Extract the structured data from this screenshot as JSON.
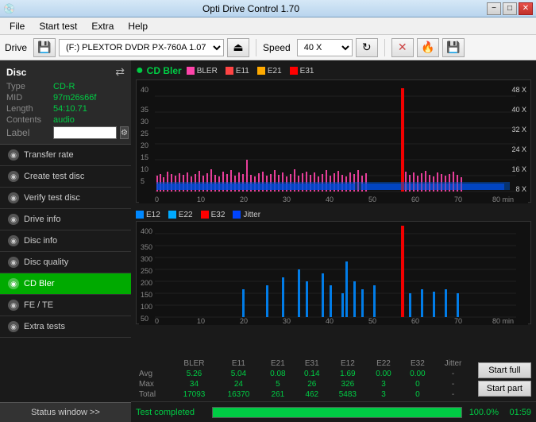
{
  "titlebar": {
    "icon": "💿",
    "title": "Opti Drive Control 1.70",
    "minimize": "−",
    "maximize": "□",
    "close": "✕"
  },
  "menubar": {
    "items": [
      "File",
      "Start test",
      "Extra",
      "Help"
    ]
  },
  "toolbar": {
    "drive_label": "Drive",
    "drive_value": "(F:)  PLEXTOR DVDR   PX-760A 1.07",
    "speed_label": "Speed",
    "speed_value": "40 X"
  },
  "disc": {
    "title": "Disc",
    "type_label": "Type",
    "type_value": "CD-R",
    "mid_label": "MID",
    "mid_value": "97m26s66f",
    "length_label": "Length",
    "length_value": "54:10.71",
    "contents_label": "Contents",
    "contents_value": "audio",
    "label_label": "Label",
    "label_value": ""
  },
  "nav": {
    "items": [
      {
        "id": "transfer-rate",
        "label": "Transfer rate",
        "active": false
      },
      {
        "id": "create-test-disc",
        "label": "Create test disc",
        "active": false
      },
      {
        "id": "verify-test-disc",
        "label": "Verify test disc",
        "active": false
      },
      {
        "id": "drive-info",
        "label": "Drive info",
        "active": false
      },
      {
        "id": "disc-info",
        "label": "Disc info",
        "active": false
      },
      {
        "id": "disc-quality",
        "label": "Disc quality",
        "active": false
      },
      {
        "id": "cd-bler",
        "label": "CD Bler",
        "active": true
      },
      {
        "id": "fe-te",
        "label": "FE / TE",
        "active": false
      },
      {
        "id": "extra-tests",
        "label": "Extra tests",
        "active": false
      }
    ],
    "status_window": "Status window >>"
  },
  "chart1": {
    "title": "CD Bler",
    "title_icon": "●",
    "legend": [
      {
        "label": "BLER",
        "color": "#ff44aa"
      },
      {
        "label": "E11",
        "color": "#ff4444"
      },
      {
        "label": "E21",
        "color": "#ffaa00"
      },
      {
        "label": "E31",
        "color": "#ff0000"
      }
    ],
    "y_max": 40,
    "x_max": 80,
    "y_right_labels": [
      "8 X",
      "16 X",
      "24 X",
      "32 X",
      "40 X",
      "48 X"
    ],
    "x_labels": [
      "0",
      "10",
      "20",
      "30",
      "40",
      "50",
      "60",
      "70",
      "80 min"
    ]
  },
  "chart2": {
    "legend": [
      {
        "label": "E12",
        "color": "#0088ff"
      },
      {
        "label": "E22",
        "color": "#00aaff"
      },
      {
        "label": "E32",
        "color": "#ff0000"
      },
      {
        "label": "Jitter",
        "color": "#0044ff"
      }
    ],
    "y_max": 400,
    "x_max": 80,
    "x_labels": [
      "0",
      "10",
      "20",
      "30",
      "40",
      "50",
      "60",
      "70",
      "80 min"
    ]
  },
  "table": {
    "headers": [
      "",
      "BLER",
      "E11",
      "E21",
      "E31",
      "E12",
      "E22",
      "E32",
      "Jitter",
      ""
    ],
    "rows": [
      {
        "label": "Avg",
        "values": [
          "5.26",
          "5.04",
          "0.08",
          "0.14",
          "1.69",
          "0.00",
          "0.00",
          "-"
        ]
      },
      {
        "label": "Max",
        "values": [
          "34",
          "24",
          "5",
          "26",
          "326",
          "3",
          "0",
          "-"
        ]
      },
      {
        "label": "Total",
        "values": [
          "17093",
          "16370",
          "261",
          "462",
          "5483",
          "3",
          "0",
          "-"
        ]
      }
    ]
  },
  "buttons": {
    "start_full": "Start full",
    "start_part": "Start part"
  },
  "progress": {
    "status": "Test completed",
    "percent": "100.0%",
    "time": "01:59"
  }
}
